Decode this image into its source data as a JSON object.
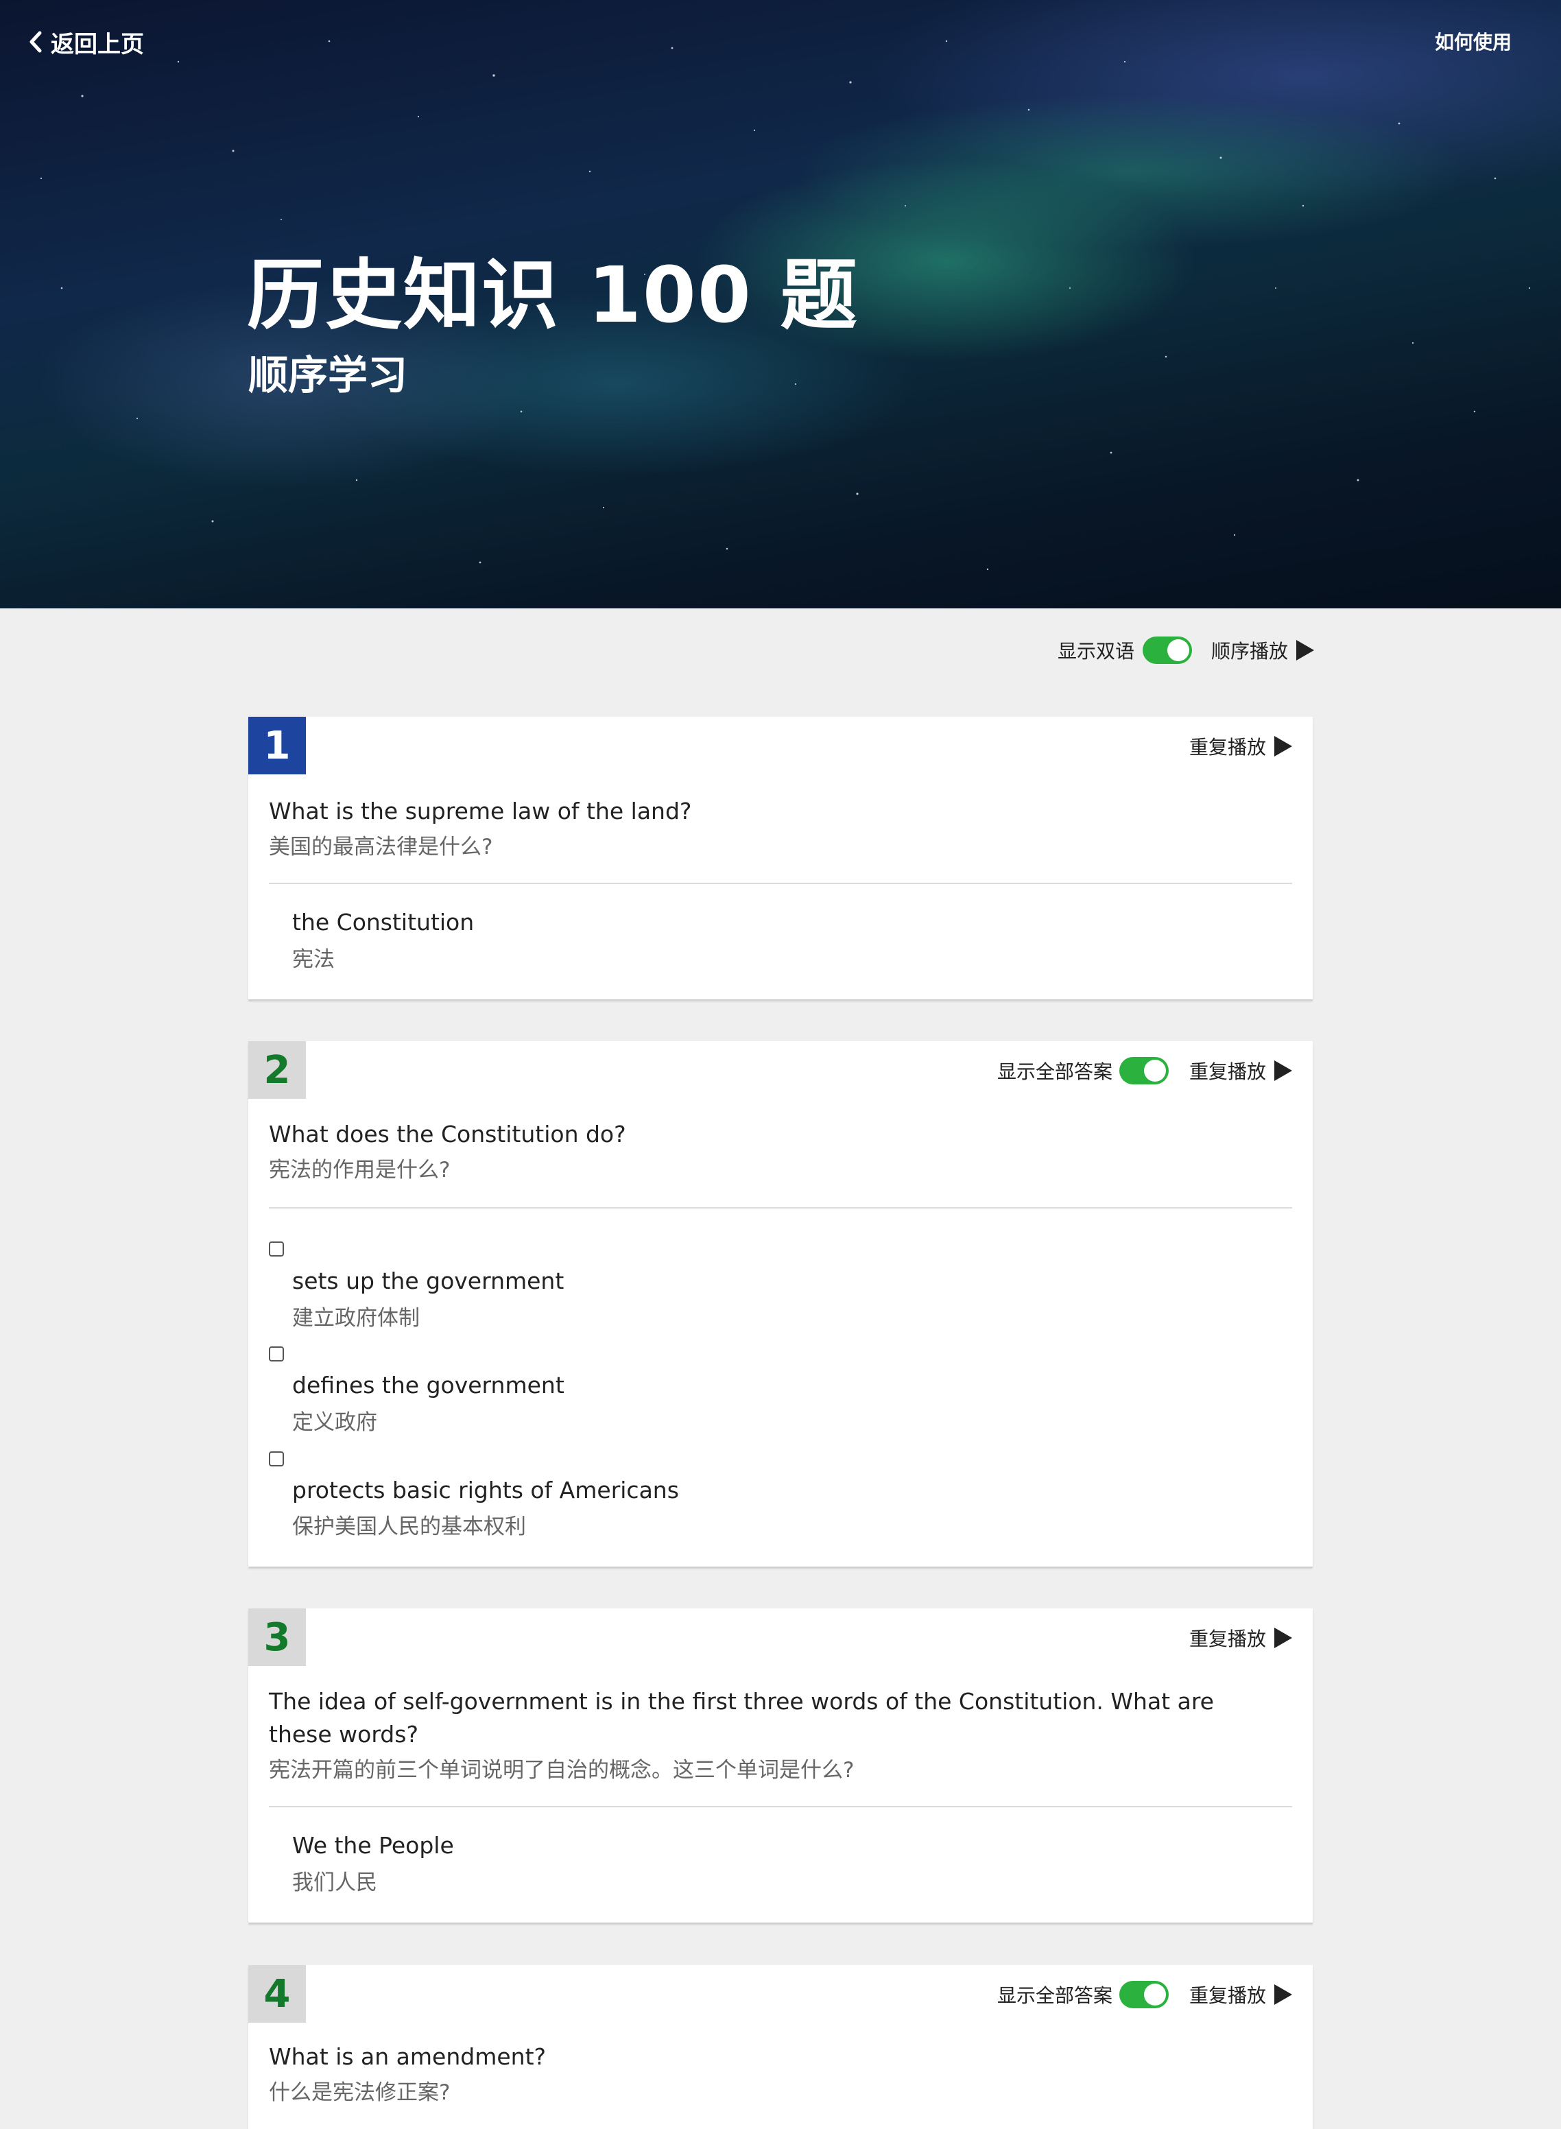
{
  "header": {
    "back_label": "返回上页",
    "help_label": "如何使用",
    "title": "历史知识 100 题",
    "subtitle": "顺序学习"
  },
  "controls": {
    "bilingual_label": "显示双语",
    "bilingual_on": true,
    "sequential_play_label": "顺序播放"
  },
  "colors": {
    "active_number_bg": "#1d45a0",
    "idle_number_text": "#137a2b",
    "toggle_on": "#2ab13e"
  },
  "questions": [
    {
      "number": "1",
      "active": true,
      "repeat_label": "重复播放",
      "question_en": "What is the supreme law of the land?",
      "question_zh": "美国的最高法律是什么?",
      "answers": [
        {
          "en": "the Constitution",
          "zh": "宪法"
        }
      ]
    },
    {
      "number": "2",
      "active": false,
      "show_all_label": "显示全部答案",
      "repeat_label": "重复播放",
      "question_en": "What does the Constitution do?",
      "question_zh": "宪法的作用是什么?",
      "answers": [
        {
          "en": "sets up the government",
          "zh": "建立政府体制",
          "checked": false
        },
        {
          "en": "defines the government",
          "zh": "定义政府",
          "checked": false
        },
        {
          "en": "protects basic rights of Americans",
          "zh": "保护美国人民的基本权利",
          "checked": false
        }
      ]
    },
    {
      "number": "3",
      "active": false,
      "repeat_label": "重复播放",
      "question_en": "The idea of self-government is in the first three words of the Constitution. What are these words?",
      "question_zh": "宪法开篇的前三个单词说明了自治的概念。这三个单词是什么?",
      "answers": [
        {
          "en": "We the People",
          "zh": "我们人民"
        }
      ]
    },
    {
      "number": "4",
      "active": false,
      "show_all_label": "显示全部答案",
      "repeat_label": "重复播放",
      "question_en": "What is an amendment?",
      "question_zh": "什么是宪法修正案?"
    }
  ]
}
